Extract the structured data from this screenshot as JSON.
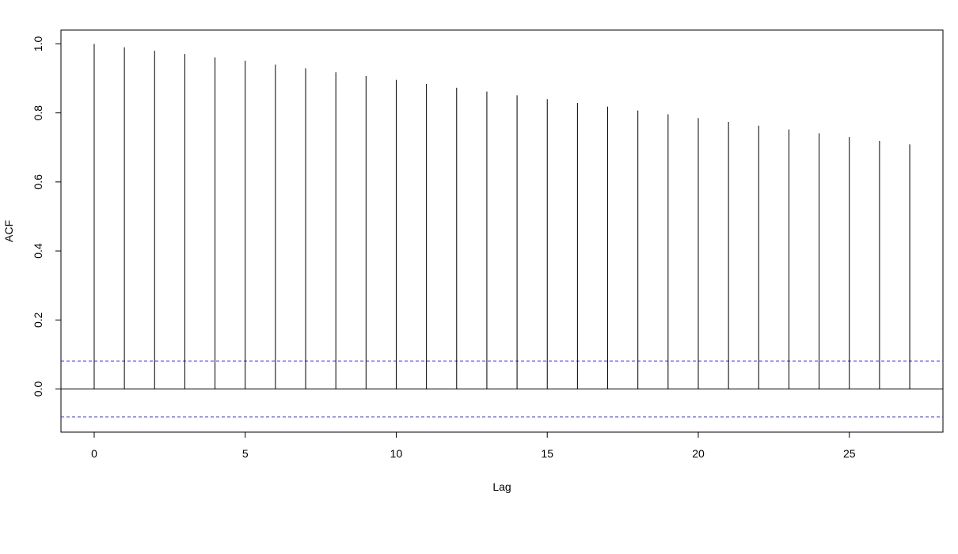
{
  "chart_data": {
    "type": "bar",
    "title": "",
    "xlabel": "Lag",
    "ylabel": "ACF",
    "lags": [
      0,
      1,
      2,
      3,
      4,
      5,
      6,
      7,
      8,
      9,
      10,
      11,
      12,
      13,
      14,
      15,
      16,
      17,
      18,
      19,
      20,
      21,
      22,
      23,
      24,
      25,
      26,
      27
    ],
    "values": [
      1.0,
      0.99,
      0.98,
      0.971,
      0.961,
      0.951,
      0.94,
      0.929,
      0.918,
      0.907,
      0.896,
      0.884,
      0.873,
      0.862,
      0.851,
      0.84,
      0.829,
      0.818,
      0.807,
      0.796,
      0.785,
      0.774,
      0.763,
      0.752,
      0.741,
      0.73,
      0.719,
      0.709
    ],
    "xlim": [
      -1.1,
      28.1
    ],
    "ylim": [
      -0.125,
      1.04
    ],
    "x_ticks": [
      0,
      5,
      10,
      15,
      20,
      25
    ],
    "y_ticks": [
      0.0,
      0.2,
      0.4,
      0.6,
      0.8,
      1.0
    ],
    "x_tick_labels": [
      "0",
      "5",
      "10",
      "15",
      "20",
      "25"
    ],
    "y_tick_labels": [
      "0.0",
      "0.2",
      "0.4",
      "0.6",
      "0.8",
      "1.0"
    ],
    "confidence_bound": 0.081,
    "bar_color": "#000000",
    "bound_color": "#3c3cd2",
    "zero_line_color": "#000000",
    "grid": false,
    "legend": "none"
  }
}
